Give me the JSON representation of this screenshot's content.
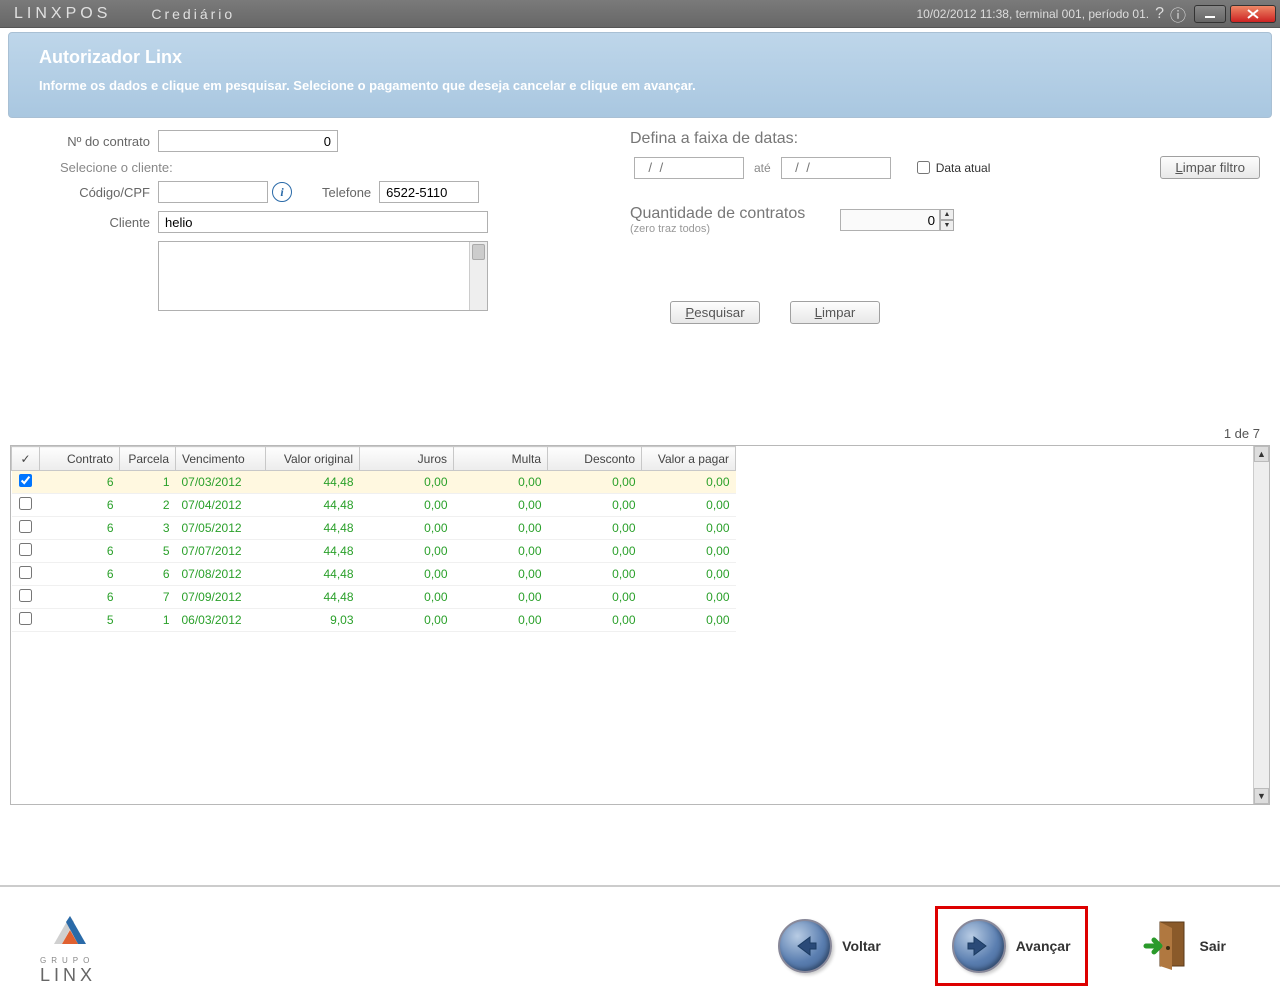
{
  "titlebar": {
    "brand": "LINXPOS",
    "module": "Crediário",
    "status": "10/02/2012 11:38, terminal 001, período 01."
  },
  "banner": {
    "title": "Autorizador Linx",
    "subtitle": "Informe os dados e clique em pesquisar. Selecione o pagamento que deseja cancelar e clique em avançar."
  },
  "form": {
    "contract_label": "Nº do contrato",
    "contract_value": "0",
    "select_client_label": "Selecione o cliente:",
    "code_label": "Código/CPF",
    "code_value": "",
    "phone_label": "Telefone",
    "phone_value": "6522-5110",
    "client_label": "Cliente",
    "client_value": "helio"
  },
  "dates": {
    "section": "Defina a faixa de datas:",
    "placeholder": "  /  /",
    "ate": "até",
    "current_label": "Data atual",
    "clear_btn": "Limpar filtro"
  },
  "qty": {
    "label": "Quantidade de contratos",
    "sub": "(zero traz todos)",
    "value": "0"
  },
  "actions": {
    "search": "Pesquisar",
    "clear": "Limpar"
  },
  "pager": "1 de 7",
  "grid": {
    "headers": {
      "check": "✓",
      "contrato": "Contrato",
      "parcela": "Parcela",
      "vencimento": "Vencimento",
      "valor_original": "Valor original",
      "juros": "Juros",
      "multa": "Multa",
      "desconto": "Desconto",
      "valor_pagar": "Valor a pagar"
    },
    "rows": [
      {
        "checked": true,
        "contrato": "6",
        "parcela": "1",
        "venc": "07/03/2012",
        "original": "44,48",
        "juros": "0,00",
        "multa": "0,00",
        "desc": "0,00",
        "pagar": "0,00"
      },
      {
        "checked": false,
        "contrato": "6",
        "parcela": "2",
        "venc": "07/04/2012",
        "original": "44,48",
        "juros": "0,00",
        "multa": "0,00",
        "desc": "0,00",
        "pagar": "0,00"
      },
      {
        "checked": false,
        "contrato": "6",
        "parcela": "3",
        "venc": "07/05/2012",
        "original": "44,48",
        "juros": "0,00",
        "multa": "0,00",
        "desc": "0,00",
        "pagar": "0,00"
      },
      {
        "checked": false,
        "contrato": "6",
        "parcela": "5",
        "venc": "07/07/2012",
        "original": "44,48",
        "juros": "0,00",
        "multa": "0,00",
        "desc": "0,00",
        "pagar": "0,00"
      },
      {
        "checked": false,
        "contrato": "6",
        "parcela": "6",
        "venc": "07/08/2012",
        "original": "44,48",
        "juros": "0,00",
        "multa": "0,00",
        "desc": "0,00",
        "pagar": "0,00"
      },
      {
        "checked": false,
        "contrato": "6",
        "parcela": "7",
        "venc": "07/09/2012",
        "original": "44,48",
        "juros": "0,00",
        "multa": "0,00",
        "desc": "0,00",
        "pagar": "0,00"
      },
      {
        "checked": false,
        "contrato": "5",
        "parcela": "1",
        "venc": "06/03/2012",
        "original": "9,03",
        "juros": "0,00",
        "multa": "0,00",
        "desc": "0,00",
        "pagar": "0,00"
      }
    ]
  },
  "footer": {
    "logo_top": "GRUPO",
    "logo_bottom": "LINX",
    "back": "Voltar",
    "next": "Avançar",
    "exit": "Sair"
  }
}
